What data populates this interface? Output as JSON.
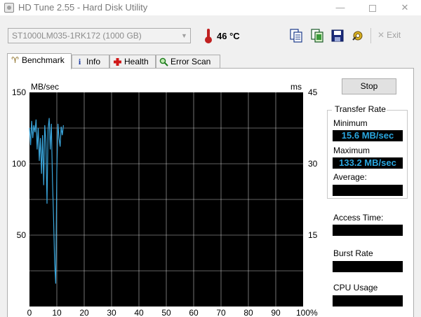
{
  "window": {
    "title": "HD Tune 2.55 - Hard Disk Utility",
    "min_glyph": "—",
    "close_glyph": "✕"
  },
  "toolbar": {
    "drive": "ST1000LM035-1RK172 (1000 GB)",
    "temperature": "46 °C",
    "exit_label": "Exit",
    "icons": [
      "copy-info-icon",
      "copy-screenshot-icon",
      "save-icon",
      "options-icon"
    ]
  },
  "tabs": [
    {
      "label": "Benchmark",
      "icon": "benchmark-icon",
      "active": true
    },
    {
      "label": "Info",
      "icon": "info-icon",
      "active": false
    },
    {
      "label": "Health",
      "icon": "health-cross-icon",
      "active": false
    },
    {
      "label": "Error Scan",
      "icon": "magnifier-icon",
      "active": false
    }
  ],
  "benchmark": {
    "stop_label": "Stop",
    "group_title": "Transfer Rate",
    "minimum_label": "Minimum",
    "minimum_value": "15.6 MB/sec",
    "maximum_label": "Maximum",
    "maximum_value": "133.2 MB/sec",
    "average_label": "Average:",
    "average_value": "",
    "access_time_label": "Access Time:",
    "access_time_value": "",
    "burst_rate_label": "Burst Rate",
    "burst_rate_value": "",
    "cpu_usage_label": "CPU Usage",
    "cpu_usage_value": ""
  },
  "chart_data": {
    "type": "line",
    "ylabel": "MB/sec",
    "ylabel_right": "ms",
    "xlim": [
      0,
      100
    ],
    "ylim": [
      0,
      150
    ],
    "ylim_right": [
      0,
      45
    ],
    "x_ticks": [
      "0",
      "10",
      "20",
      "30",
      "40",
      "50",
      "60",
      "70",
      "80",
      "90",
      "100%"
    ],
    "y_ticks": [
      "50",
      "100",
      "150"
    ],
    "y_ticks_right": [
      "15",
      "30",
      "45"
    ],
    "grid": true,
    "background": "#000000",
    "grid_color": "#ffffff",
    "series": [
      {
        "color": "#3aa6dc",
        "x": [
          0,
          0.4,
          0.8,
          1.2,
          1.6,
          2.0,
          2.4,
          2.8,
          3.2,
          3.6,
          4.0,
          4.4,
          4.8,
          5.2,
          5.6,
          6.0,
          6.4,
          6.8,
          7.2,
          7.6,
          8.0,
          8.4,
          8.8,
          9.2,
          9.6,
          10.0,
          10.4,
          10.8,
          11.2,
          11.6,
          12.0,
          12.4
        ],
        "y": [
          125,
          113,
          130,
          118,
          127,
          122,
          131,
          110,
          125,
          102,
          118,
          93,
          120,
          85,
          127,
          115,
          72,
          124,
          132,
          110,
          128,
          88,
          63,
          30,
          16,
          96,
          128,
          118,
          112,
          126,
          120,
          127
        ]
      }
    ]
  }
}
